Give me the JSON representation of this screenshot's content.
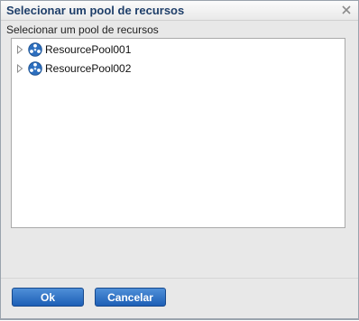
{
  "dialog": {
    "title": "Selecionar um pool de recursos",
    "close_icon": "close-icon"
  },
  "content": {
    "label": "Selecionar um pool de recursos",
    "tree": [
      {
        "label": "ResourcePool001",
        "icon": "resource-pool-icon",
        "expanded": false
      },
      {
        "label": "ResourcePool002",
        "icon": "resource-pool-icon",
        "expanded": false
      }
    ]
  },
  "buttons": {
    "ok": "Ok",
    "cancel": "Cancelar"
  },
  "colors": {
    "title_text": "#1f3f6a",
    "button_bg": "#2b6cc4",
    "dialog_bg": "#e8e8e8"
  }
}
